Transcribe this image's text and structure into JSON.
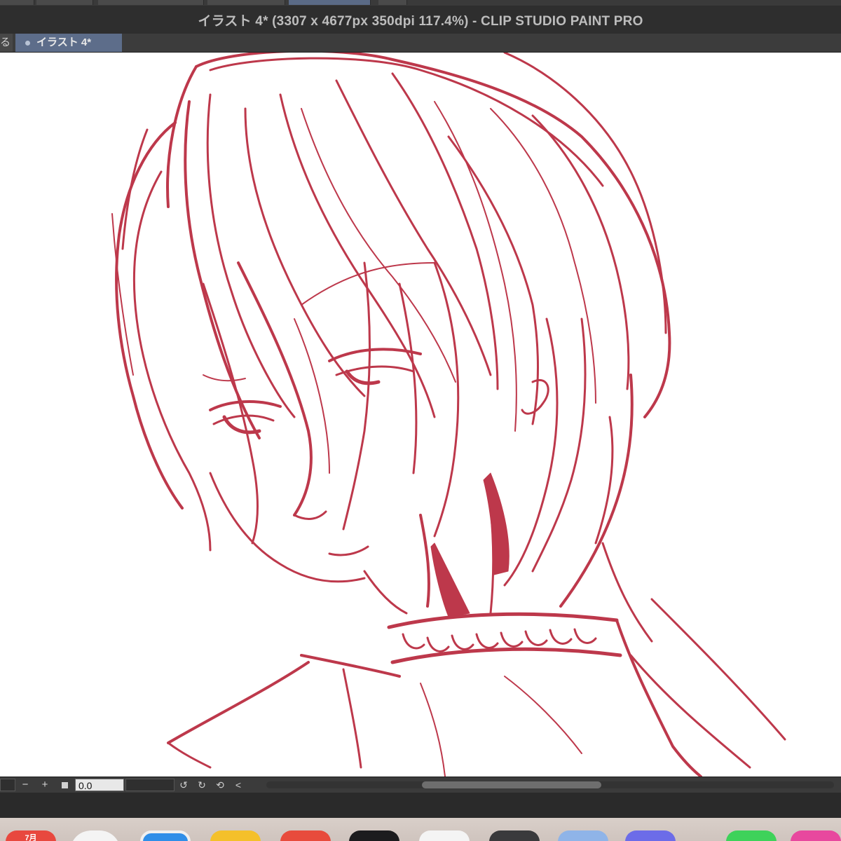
{
  "window": {
    "title": "イラスト 4* (3307 x 4677px 350dpi 117.4%)  - CLIP STUDIO PAINT PRO"
  },
  "tabs": {
    "previous_partial": "る",
    "active": "イラスト 4*"
  },
  "statusbar": {
    "zoom_out_glyph": "−",
    "zoom_in_glyph": "+",
    "value": "0.0",
    "rotate_left_icon": "rotate-ccw-icon",
    "rotate_right_icon": "rotate-cw-icon",
    "reset_icon": "reset-rotation-icon",
    "collapse_glyph": "<"
  },
  "dock": {
    "calendar_label": "7月"
  },
  "colors": {
    "sketch_red": "#b8283c",
    "tab_active": "#5d6d8a"
  }
}
